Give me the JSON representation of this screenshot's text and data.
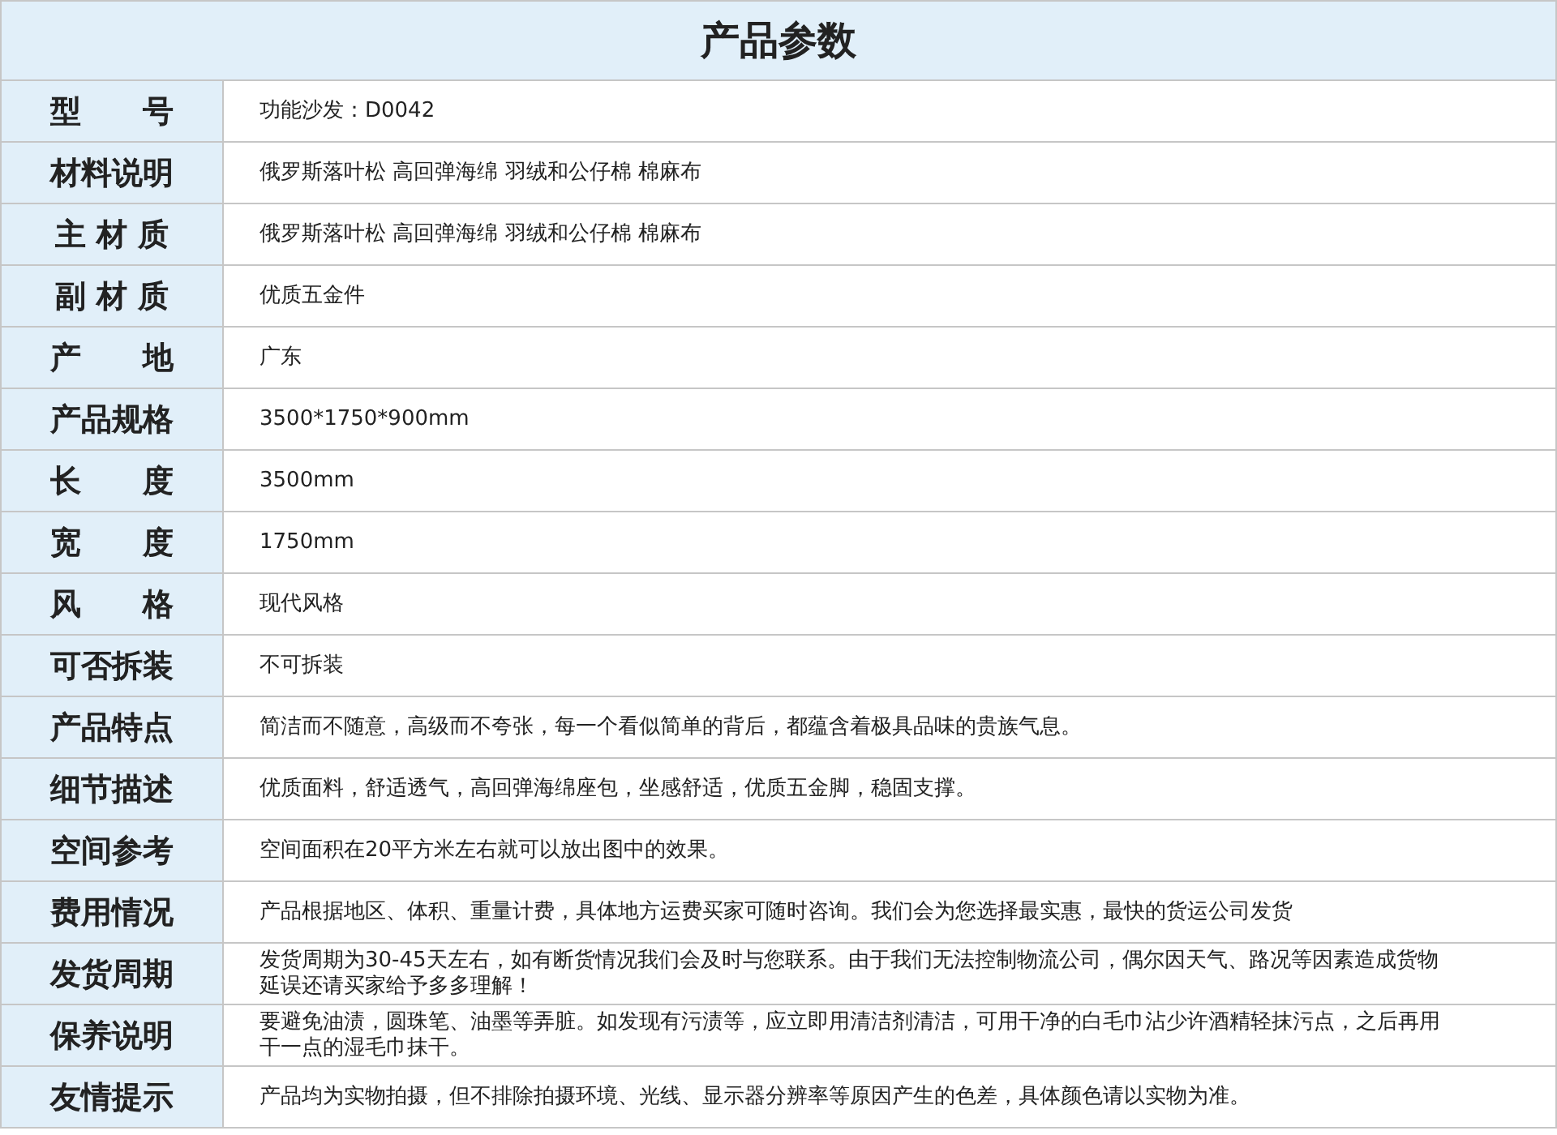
{
  "title": "产品参数",
  "rows": [
    {
      "label": "型　　号",
      "value": "功能沙发：D0042"
    },
    {
      "label": "材料说明",
      "value": "俄罗斯落叶松 高回弹海绵 羽绒和公仔棉 棉麻布"
    },
    {
      "label": "主 材 质",
      "value": "俄罗斯落叶松 高回弹海绵 羽绒和公仔棉 棉麻布"
    },
    {
      "label": "副 材 质",
      "value": "优质五金件"
    },
    {
      "label": "产　　地",
      "value": "广东"
    },
    {
      "label": "产品规格",
      "value": "3500*1750*900mm"
    },
    {
      "label": "长　　度",
      "value": "3500mm"
    },
    {
      "label": "宽　　度",
      "value": "1750mm"
    },
    {
      "label": "风　　格",
      "value": "现代风格"
    },
    {
      "label": "可否拆装",
      "value": "不可拆装"
    },
    {
      "label": "产品特点",
      "value": "简洁而不随意，高级而不夸张，每一个看似简单的背后，都蕴含着极具品味的贵族气息。"
    },
    {
      "label": "细节描述",
      "value": "优质面料，舒适透气，高回弹海绵座包，坐感舒适，优质五金脚，稳固支撑。"
    },
    {
      "label": "空间参考",
      "value": "空间面积在20平方米左右就可以放出图中的效果。"
    },
    {
      "label": "费用情况",
      "value": "产品根据地区、体积、重量计费，具体地方运费买家可随时咨询。我们会为您选择最实惠，最快的货运公司发货"
    },
    {
      "label": "发货周期",
      "value": "发货周期为30-45天左右，如有断货情况我们会及时与您联系。由于我们无法控制物流公司，偶尔因天气、路况等因素造成货物延误还请买家给予多多理解！"
    },
    {
      "label": "保养说明",
      "value": "要避免油渍，圆珠笔、油墨等弄脏。如发现有污渍等，应立即用清洁剂清洁，可用干净的白毛巾沾少许酒精轻抹污点，之后再用干一点的湿毛巾抹干。"
    },
    {
      "label": "友情提示",
      "value": "产品均为实物拍摄，但不排除拍摄环境、光线、显示器分辨率等原因产生的色差，具体颜色请以实物为准。"
    }
  ]
}
